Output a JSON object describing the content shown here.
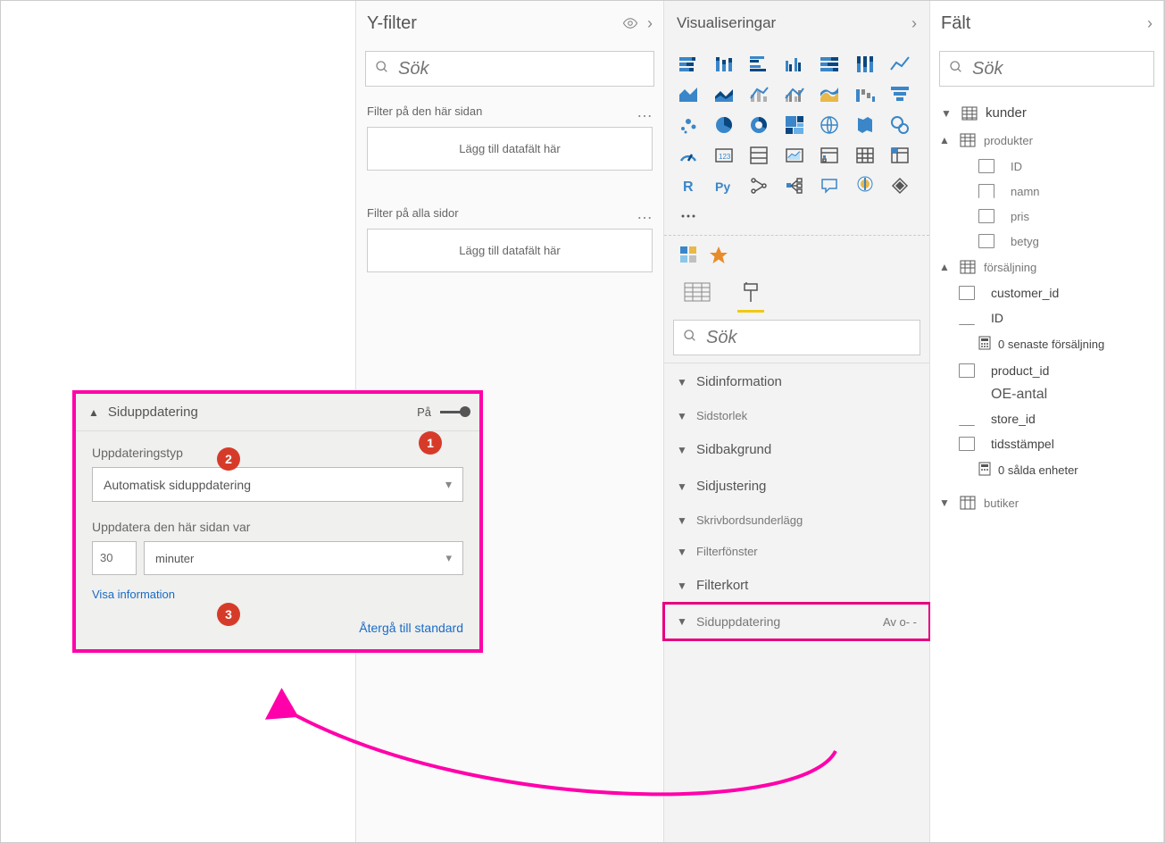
{
  "filters": {
    "title": "Y-filter",
    "search_placeholder": "Sök",
    "section_page": {
      "title": "Filter på den här sidan",
      "drop": "Lägg till datafält här"
    },
    "section_all": {
      "title": "Filter på alla sidor",
      "drop": "Lägg till datafält här"
    }
  },
  "viz": {
    "title": "Visualiseringar",
    "search_placeholder": "Sök",
    "sections": {
      "page_info": "Sidinformation",
      "page_size": "Sidstorlek",
      "page_bg": "Sidbakgrund",
      "page_align": "Sidjustering",
      "wallpaper": "Skrivbordsunderlägg",
      "filter_pane": "Filterfönster",
      "filter_card": "Filterkort",
      "page_refresh": "Siduppdatering",
      "page_refresh_value": "Av o-    -"
    }
  },
  "fields": {
    "title": "Fält",
    "search_placeholder": "Sök",
    "tables": {
      "kunder": "kunder",
      "produkter": "produkter",
      "butiker": "butiker",
      "forsaljning": "försäljning"
    },
    "produkter_fields": {
      "id": "ID",
      "namn": "namn",
      "pris": "pris",
      "betyg": "betyg"
    },
    "forsaljning_fields": {
      "customer_id": "customer_id",
      "id": "ID",
      "senaste": "0 senaste försäljning",
      "product_id": "product_id",
      "oe_antal": "OE-antal",
      "store_id": "store_id",
      "tidsstampel": "tidsstämpel",
      "salda": "0 sålda enheter"
    }
  },
  "callout": {
    "title": "Siduppdatering",
    "toggle_label": "På",
    "type_label": "Uppdateringstyp",
    "type_value": "Automatisk siduppdatering",
    "interval_label": "Uppdatera den här sidan var",
    "interval_value": "30",
    "interval_unit": "minuter",
    "show_info": "Visa information",
    "reset": "Återgå till standard",
    "badges": {
      "one": "1",
      "two": "2",
      "three": "3"
    }
  }
}
